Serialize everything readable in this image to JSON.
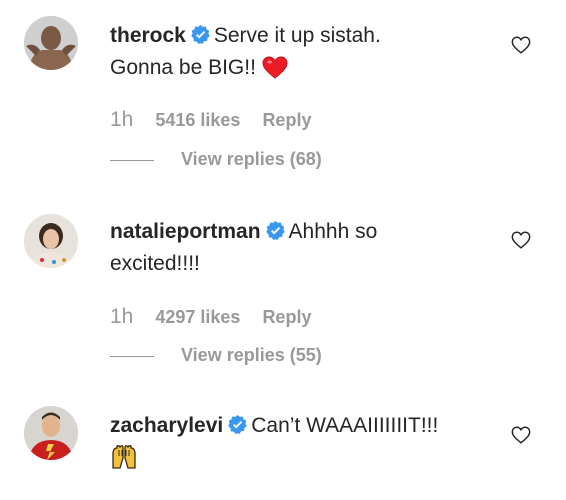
{
  "comments": [
    {
      "username": "therock",
      "text": "Serve it up sistah.",
      "text2": "Gonna be BIG!!",
      "emoji": "red-heart",
      "time": "1h",
      "likes": "5416 likes",
      "reply": "Reply",
      "view_replies": "View replies (68)"
    },
    {
      "username": "natalieportman",
      "text": "Ahhhh so",
      "text2": "excited!!!!",
      "time": "1h",
      "likes": "4297 likes",
      "reply": "Reply",
      "view_replies": "View replies (55)"
    },
    {
      "username": "zacharylevi",
      "text": "Can’t WAAAIIIIIIIT!!!",
      "emoji": "raising-hands"
    }
  ],
  "colors": {
    "verified": "#3897f0",
    "meta_text": "#999999",
    "heart": "#ed1c24"
  },
  "icons": [
    "verified-badge-icon",
    "like-heart-icon",
    "red-heart-emoji",
    "raising-hands-emoji"
  ]
}
